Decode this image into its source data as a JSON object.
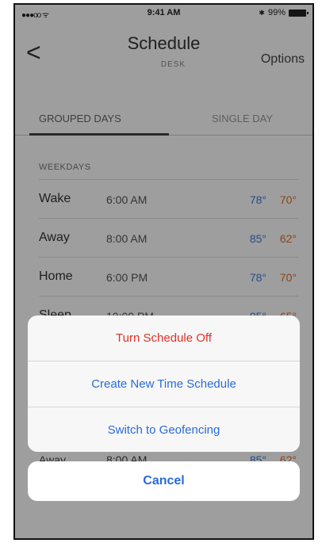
{
  "status_bar": {
    "signal": "●●●oo ᯤ",
    "time": "9:41 AM",
    "battery": "99%"
  },
  "nav": {
    "back": "<",
    "title": "Schedule",
    "subtitle": "DESK",
    "options": "Options"
  },
  "tabs": [
    {
      "label": "GROUPED DAYS"
    },
    {
      "label": "SINGLE DAY"
    }
  ],
  "section": {
    "title": "WEEKDAYS"
  },
  "rows": [
    {
      "label": "Wake",
      "time": "6:00 AM",
      "cool": "78°",
      "heat": "70°"
    },
    {
      "label": "Away",
      "time": "8:00 AM",
      "cool": "85°",
      "heat": "62°"
    },
    {
      "label": "Home",
      "time": "6:00 PM",
      "cool": "78°",
      "heat": "70°"
    },
    {
      "label": "Sleep",
      "time": "10:00 PM",
      "cool": "85°",
      "heat": "65°"
    }
  ],
  "peek_row": {
    "label": "Away",
    "time": "8:00 AM",
    "cool": "85°",
    "heat": "62°"
  },
  "action_sheet": {
    "items": [
      {
        "label": "Turn Schedule Off"
      },
      {
        "label": "Create New Time Schedule"
      },
      {
        "label": "Switch to Geofencing"
      }
    ],
    "cancel": "Cancel"
  },
  "colors": {
    "accent": "#2a6bd6",
    "danger": "#e0322a",
    "cool": "#3a7bd5",
    "heat": "#e0702a"
  }
}
